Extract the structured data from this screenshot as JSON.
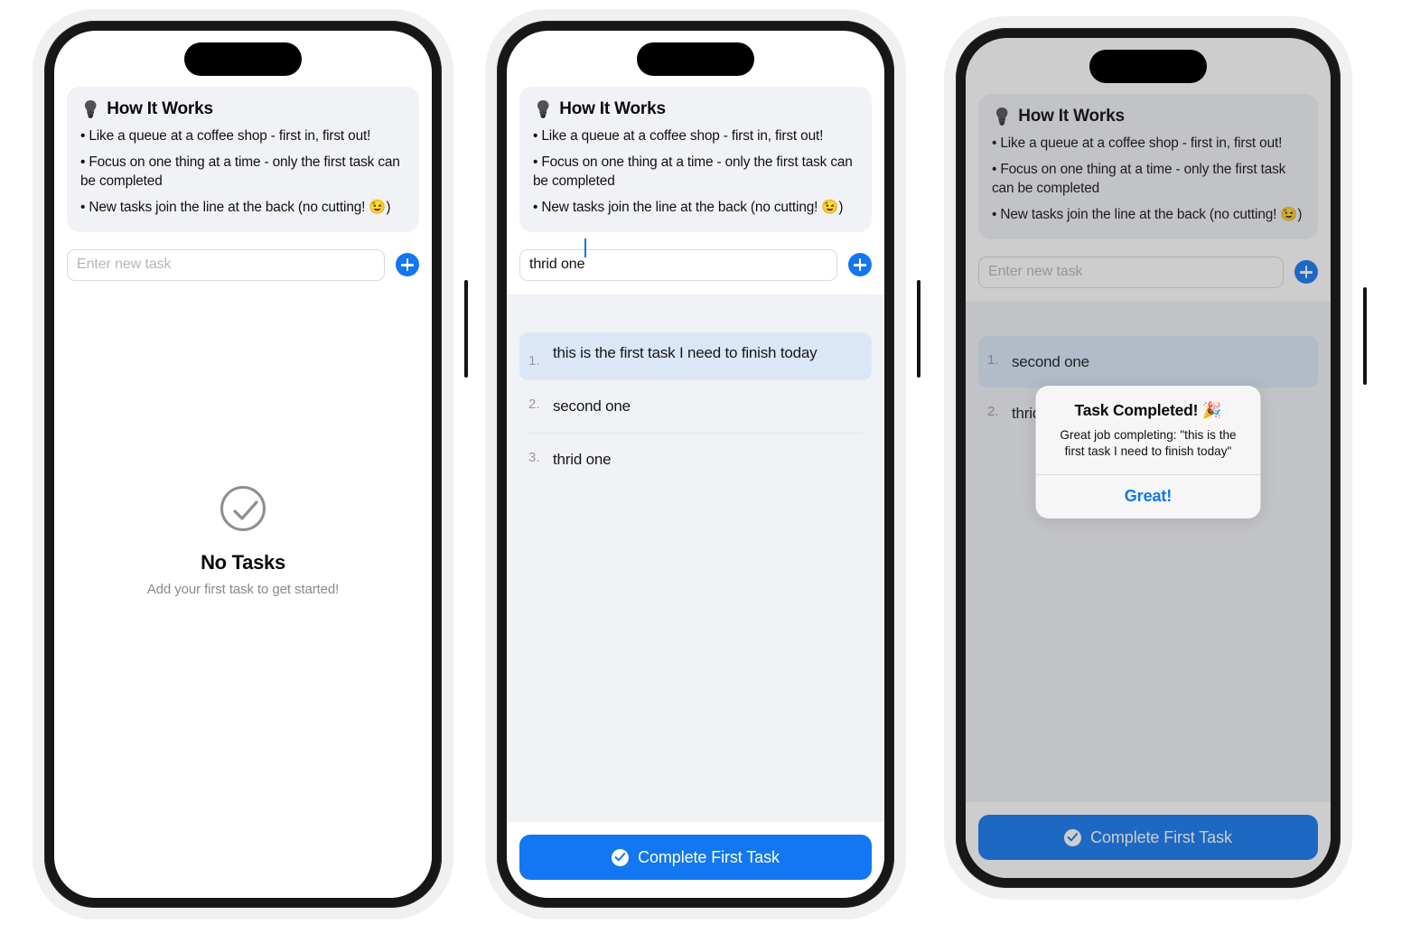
{
  "colors": {
    "accent": "#1277f0",
    "frame_outer": "#f0f0f0",
    "bezel": "#171717",
    "info_card_bg": "#f1f2f6",
    "list_bg": "#f1f2f6",
    "first_task_highlight": "#dbe7f7",
    "muted_text": "#8a8a8e",
    "dialog_bg": "#f6f6f7",
    "dim_overlay": "rgba(60,60,67,0.26)"
  },
  "info_card": {
    "icon": "lightbulb-icon",
    "title": "How It Works",
    "bullets": [
      "• Like a queue at a coffee shop - first in, first out!",
      "• Focus on one thing at a time - only the first task can be completed",
      "• New tasks join the line at the back (no cutting! 😉)"
    ]
  },
  "composer": {
    "placeholder": "Enter new task",
    "add_icon": "plus-icon",
    "value_empty": "",
    "value_typed": "thrid one"
  },
  "empty_state": {
    "icon": "check-circle-icon",
    "title": "No Tasks",
    "subtitle": "Add your first task to get started!"
  },
  "cta": {
    "icon": "check-circle-filled-icon",
    "label": "Complete First Task"
  },
  "dialog": {
    "title": "Task Completed! 🎉",
    "message": "Great job completing: \"this is the first task I need to finish today\"",
    "button": "Great!"
  },
  "phones": [
    {
      "name": "phone-empty-state",
      "state": "empty",
      "input_value": "",
      "tasks": []
    },
    {
      "name": "phone-task-list",
      "state": "list",
      "input_value": "thrid one",
      "tasks": [
        {
          "num": "1.",
          "text": "this is the first task I need to finish today"
        },
        {
          "num": "2.",
          "text": "second one"
        },
        {
          "num": "3.",
          "text": "thrid one"
        }
      ]
    },
    {
      "name": "phone-completion-dialog",
      "state": "dialog",
      "input_value": "",
      "tasks": [
        {
          "num": "1.",
          "text": "second one"
        },
        {
          "num": "2.",
          "text": "thrid one"
        }
      ]
    }
  ]
}
